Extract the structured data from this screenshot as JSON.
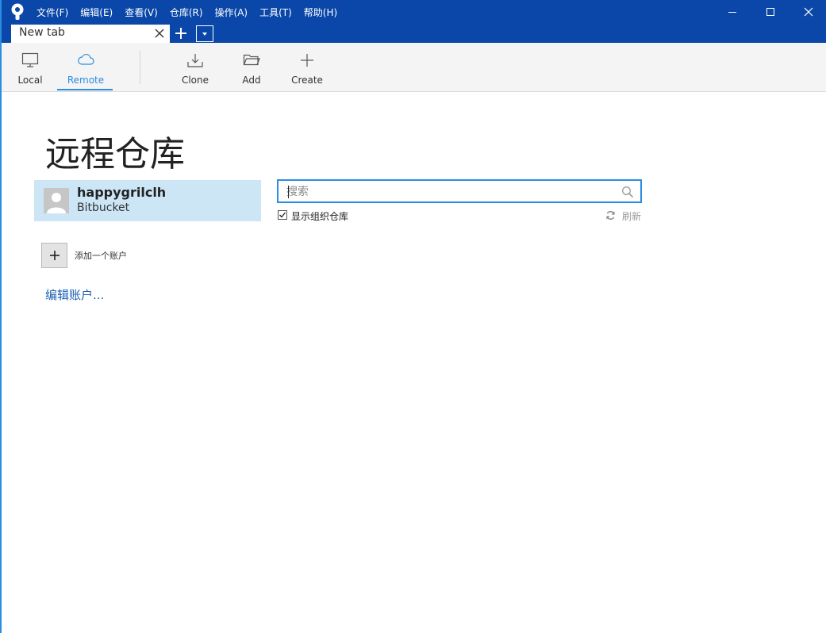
{
  "menubar": {
    "items": [
      "文件(F)",
      "编辑(E)",
      "查看(V)",
      "仓库(R)",
      "操作(A)",
      "工具(T)",
      "帮助(H)"
    ]
  },
  "tabs": {
    "active_label": "New tab"
  },
  "toolbar": {
    "local": {
      "label": "Local",
      "icon": "monitor-icon"
    },
    "remote": {
      "label": "Remote",
      "icon": "cloud-icon"
    },
    "clone": {
      "label": "Clone",
      "icon": "download-icon"
    },
    "add": {
      "label": "Add",
      "icon": "folder-icon"
    },
    "create": {
      "label": "Create",
      "icon": "plus-icon"
    }
  },
  "main": {
    "title": "远程仓库",
    "account": {
      "username": "happygrilclh",
      "service": "Bitbucket"
    },
    "add_account_label": "添加一个账户",
    "edit_accounts_link": "编辑账户...",
    "search": {
      "placeholder": "搜索",
      "value": ""
    },
    "show_org_repos": {
      "label": "显示组织仓库",
      "checked": true
    },
    "refresh_label": "刷新"
  },
  "colors": {
    "titlebar": "#0a47a9",
    "accent": "#2b8de0",
    "selected_account_bg": "#cce6f6",
    "link": "#1a5fb4"
  }
}
